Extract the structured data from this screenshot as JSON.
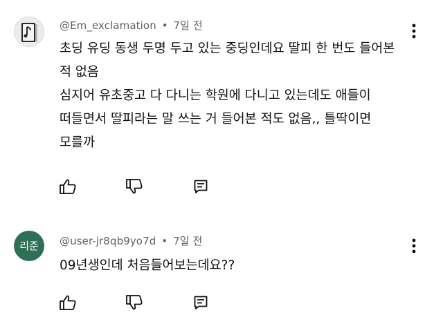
{
  "comments": [
    {
      "author": "@Em_exclamation",
      "separator": "•",
      "time": "7일 전",
      "avatar": {
        "kind": "photo",
        "icon": "notebook-avatar"
      },
      "lines": [
        "초딩 유딩 동생 두명 두고 있는 중딩인데요 딸피 한 번도 들어본",
        "적 없음",
        "심지어 유초중고 다 다니는 학원에 다니고 있는데도 애들이",
        "떠들면서 딸피라는 말 쓰는 거 들어본 적도 없음,, 틀딱이면",
        "모를까"
      ],
      "actions": {
        "like_icon": "thumbs-up-icon",
        "dislike_icon": "thumbs-down-icon",
        "reply_icon": "reply-icon",
        "more_icon": "more-vertical-icon"
      }
    },
    {
      "author": "@user-jr8qb9yo7d",
      "separator": "•",
      "time": "7일 전",
      "avatar": {
        "kind": "initials",
        "text": "리준",
        "color": "#2f6f57"
      },
      "lines": [
        "09년생인데 처음들어보는데요??"
      ],
      "actions": {
        "like_icon": "thumbs-up-icon",
        "dislike_icon": "thumbs-down-icon",
        "reply_icon": "reply-icon",
        "more_icon": "more-vertical-icon"
      }
    }
  ],
  "colors": {
    "text": "#111111",
    "meta": "#606060",
    "icon": "#0f0f0f",
    "avatar_initials_bg": "#2f6f57"
  }
}
